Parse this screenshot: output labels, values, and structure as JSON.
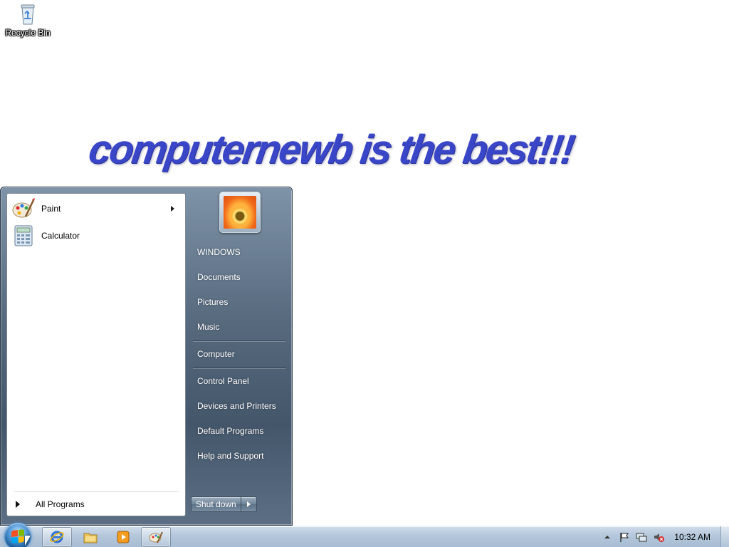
{
  "desktop": {
    "icons": [
      {
        "label": "Recycle Bin",
        "icon": "recycle-bin-icon"
      }
    ],
    "wallpaper_text": "computernewb is the best!!!"
  },
  "start_menu": {
    "pinned_programs": [
      {
        "label": "Paint",
        "icon": "paint-icon",
        "has_submenu": true
      },
      {
        "label": "Calculator",
        "icon": "calculator-icon",
        "has_submenu": false
      }
    ],
    "all_programs_label": "All Programs",
    "user_picture": "user-picture-flower",
    "right_items": [
      {
        "label": "WINDOWS",
        "group": 1
      },
      {
        "label": "Documents",
        "group": 1
      },
      {
        "label": "Pictures",
        "group": 1
      },
      {
        "label": "Music",
        "group": 1
      },
      {
        "label": "Computer",
        "group": 2
      },
      {
        "label": "Control Panel",
        "group": 3
      },
      {
        "label": "Devices and Printers",
        "group": 3
      },
      {
        "label": "Default Programs",
        "group": 3
      },
      {
        "label": "Help and Support",
        "group": 3
      }
    ],
    "shutdown_label": "Shut down"
  },
  "taskbar": {
    "pinned": [
      {
        "name": "internet-explorer-icon",
        "active": true
      },
      {
        "name": "windows-explorer-icon",
        "active": false
      },
      {
        "name": "media-player-icon",
        "active": false
      },
      {
        "name": "paint-icon",
        "active": true
      }
    ],
    "tray": {
      "icons": [
        "show-hidden-icons-icon",
        "action-center-flag-icon",
        "network-icon",
        "volume-muted-icon"
      ],
      "clock": "10:32 AM"
    }
  },
  "colors": {
    "wallpaper_text": "#3a46c8",
    "taskbar": "#b4c7db",
    "start_menu_right": "#56697d"
  }
}
